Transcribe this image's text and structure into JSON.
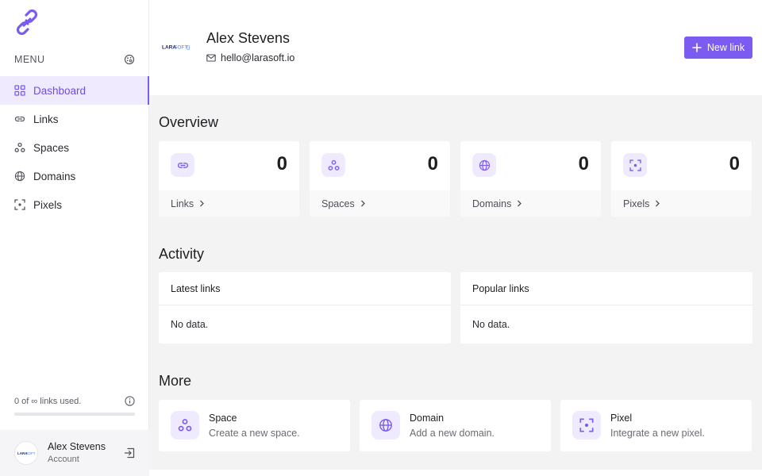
{
  "colors": {
    "accent": "#7c5bf1",
    "accent_soft": "#efeafd",
    "background": "#f3f3f4"
  },
  "sidebar": {
    "menu_label": "MENU",
    "items": [
      {
        "label": "Dashboard",
        "icon": "dashboard-icon",
        "active": true
      },
      {
        "label": "Links",
        "icon": "link-icon"
      },
      {
        "label": "Spaces",
        "icon": "spaces-icon"
      },
      {
        "label": "Domains",
        "icon": "globe-icon"
      },
      {
        "label": "Pixels",
        "icon": "pixel-icon"
      }
    ],
    "usage": {
      "text": "0 of ∞ links used.",
      "progress": 0
    },
    "account": {
      "name": "Alex Stevens",
      "subtitle": "Account"
    }
  },
  "header": {
    "brand": {
      "part1": "LARA",
      "part2": "SOFT",
      "part3": "{}"
    },
    "name": "Alex Stevens",
    "email": "hello@larasoft.io",
    "new_link_label": "New link"
  },
  "overview": {
    "title": "Overview",
    "cards": [
      {
        "label": "Links",
        "value": "0",
        "icon": "link-icon"
      },
      {
        "label": "Spaces",
        "value": "0",
        "icon": "spaces-icon"
      },
      {
        "label": "Domains",
        "value": "0",
        "icon": "globe-icon"
      },
      {
        "label": "Pixels",
        "value": "0",
        "icon": "pixel-icon"
      }
    ]
  },
  "activity": {
    "title": "Activity",
    "cards": [
      {
        "title": "Latest links",
        "body": "No data."
      },
      {
        "title": "Popular links",
        "body": "No data."
      }
    ]
  },
  "more": {
    "title": "More",
    "cards": [
      {
        "title": "Space",
        "subtitle": "Create a new space.",
        "icon": "spaces-icon"
      },
      {
        "title": "Domain",
        "subtitle": "Add a new domain.",
        "icon": "globe-icon"
      },
      {
        "title": "Pixel",
        "subtitle": "Integrate a new pixel.",
        "icon": "pixel-icon"
      }
    ]
  }
}
